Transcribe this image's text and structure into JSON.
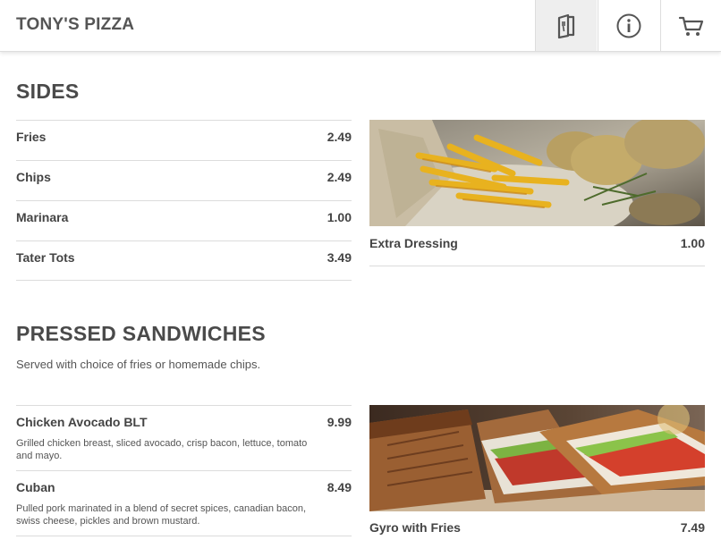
{
  "header": {
    "brand": "TONY'S PIZZA",
    "nav": [
      {
        "icon": "menu-book-icon",
        "active": true
      },
      {
        "icon": "info-icon",
        "active": false
      },
      {
        "icon": "cart-icon",
        "active": false
      }
    ]
  },
  "sides": {
    "title": "SIDES",
    "items": [
      {
        "name": "Fries",
        "price": "2.49"
      },
      {
        "name": "Chips",
        "price": "2.49"
      },
      {
        "name": "Marinara",
        "price": "1.00"
      },
      {
        "name": "Tater Tots",
        "price": "3.49"
      }
    ],
    "featured": {
      "name": "Extra Dressing",
      "price": "1.00",
      "image": "fries-photo"
    }
  },
  "sandwiches": {
    "title": "PRESSED SANDWICHES",
    "description": "Served with choice of fries or homemade chips.",
    "items": [
      {
        "name": "Chicken Avocado BLT",
        "price": "9.99",
        "description": "Grilled chicken breast, sliced avocado, crisp bacon, lettuce, tomato and mayo."
      },
      {
        "name": "Cuban",
        "price": "8.49",
        "description": "Pulled pork marinated in a blend of secret spices, canadian bacon, swiss cheese, pickles and brown mustard."
      }
    ],
    "featured": {
      "name": "Gyro with Fries",
      "price": "7.49",
      "image": "sandwich-photo"
    }
  },
  "colors": {
    "accent": "#555555",
    "divider": "#dcdcdc",
    "active_nav": "#eeeeee"
  }
}
